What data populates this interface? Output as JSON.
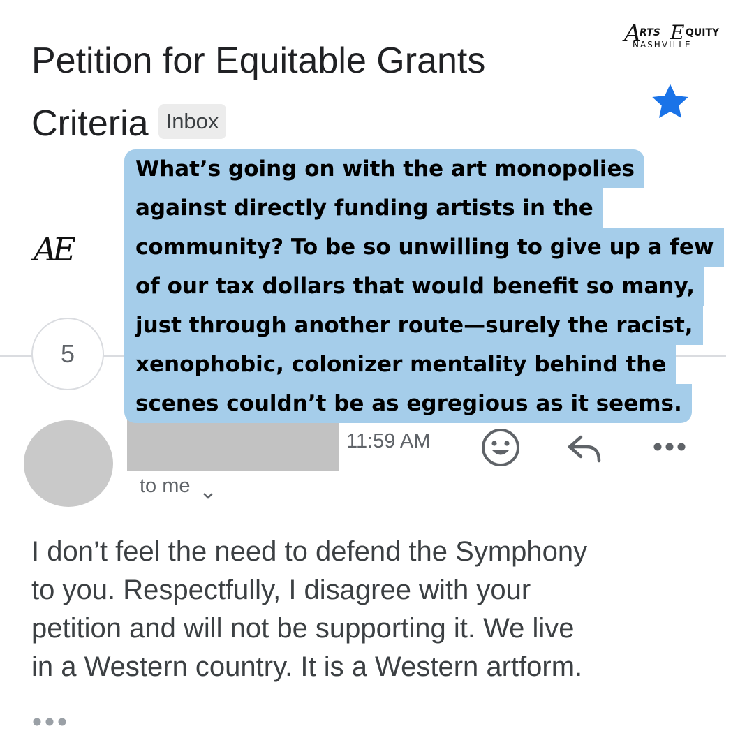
{
  "subject": {
    "line1": "Petition for Equitable Grants",
    "line2": "Criteria",
    "label_chip": "Inbox"
  },
  "logo": {
    "script_a": "A",
    "arts": "RTS",
    "script_e": "E",
    "quity": "QUITY",
    "city": "NASHVILLE"
  },
  "monogram": "AE",
  "collapsed_count": "5",
  "quote": {
    "lines": [
      "What’s going on with the art monopolies",
      "against directly funding artists in the",
      "community? To be so unwilling to give up a few",
      "of our tax dollars that would benefit so many,",
      "just through another route—surely the racist,",
      "xenophobic, colonizer mentality behind the",
      "scenes couldn’t be as egregious as it seems."
    ]
  },
  "message": {
    "time": "11:59 AM",
    "recipient_label": "to me",
    "body_lines": [
      "I don’t feel the need to defend the Symphony",
      "to you. Respectfully, I disagree with your",
      "petition and will not be supporting it. We live",
      "in a Western country. It is a Western artform."
    ]
  },
  "colors": {
    "highlight": "#a5cdea",
    "star": "#1a73e8",
    "avatar": "#c9c9c9",
    "redaction": "#c2c2c2"
  },
  "icons": [
    "star-icon",
    "emoji-icon",
    "reply-icon",
    "more-icon",
    "chevron-down-icon"
  ]
}
